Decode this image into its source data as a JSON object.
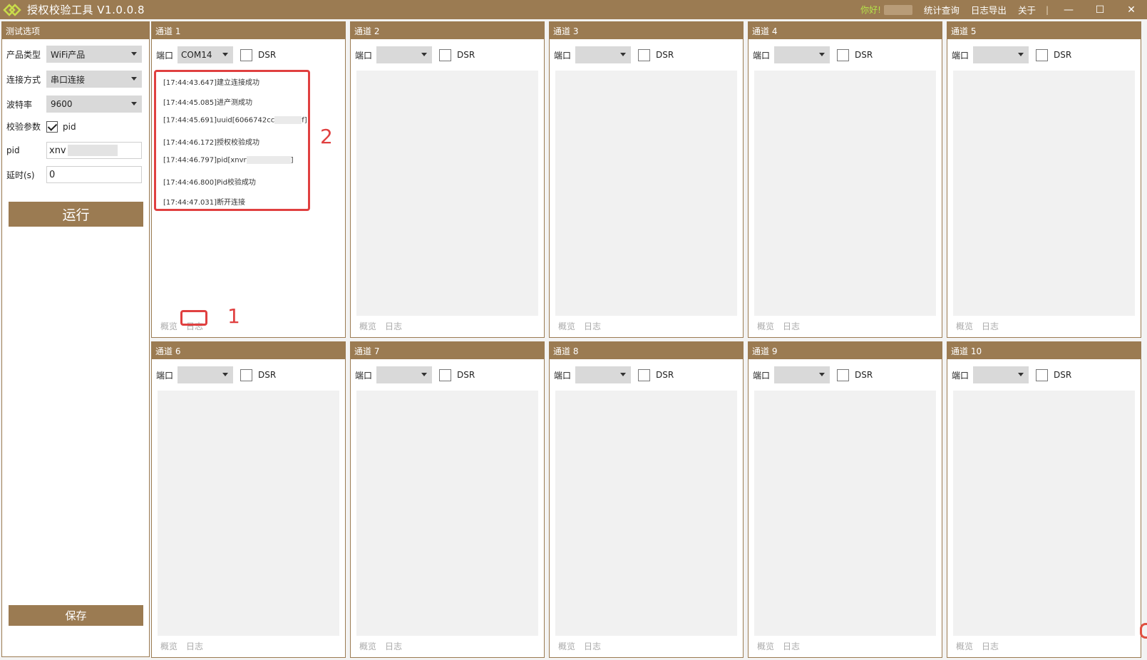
{
  "titlebar": {
    "title": "授权校验工具 V1.0.0.8",
    "greeting": "你好!",
    "menu": [
      "统计查询",
      "日志导出",
      "关于"
    ],
    "separator": "|",
    "window_buttons": {
      "minimize": "—",
      "maximize": "☐",
      "close": "✕"
    }
  },
  "left_panel": {
    "header": "测试选项",
    "product_type_label": "产品类型",
    "product_type_value": "WiFi产品",
    "connect_label": "连接方式",
    "connect_value": "串口连接",
    "baud_label": "波特率",
    "baud_value": "9600",
    "verify_label": "校验参数",
    "verify_option": "pid",
    "pid_label": "pid",
    "pid_value": "xnv",
    "delay_label": "延时(s)",
    "delay_value": "0",
    "run_label": "运行",
    "save_label": "保存"
  },
  "channel_common": {
    "port_label": "端口",
    "dsr_label": "DSR",
    "tab_overview": "概览",
    "tab_log": "日志"
  },
  "channels": [
    {
      "title": "通道 1",
      "port": "COM14"
    },
    {
      "title": "通道 2",
      "port": ""
    },
    {
      "title": "通道 3",
      "port": ""
    },
    {
      "title": "通道 4",
      "port": ""
    },
    {
      "title": "通道 5",
      "port": ""
    },
    {
      "title": "通道 6",
      "port": ""
    },
    {
      "title": "通道 7",
      "port": ""
    },
    {
      "title": "通道 8",
      "port": ""
    },
    {
      "title": "通道 9",
      "port": ""
    },
    {
      "title": "通道 10",
      "port": ""
    }
  ],
  "log_lines": [
    "[17:44:43.647]建立连接成功",
    "[17:44:45.085]进产测成功",
    "[17:44:45.691]uuid[6066742cc",
    "[17:44:46.172]授权校验成功",
    "[17:44:46.797]pid[xnvr",
    "[17:44:46.800]Pid校验成功",
    "[17:44:47.031]断开连接"
  ],
  "log_line_suffix": {
    "uuid": "f]",
    "pid": "]"
  },
  "annotations": {
    "one": "1",
    "two": "2"
  },
  "colors": {
    "brand": "#9b7b52",
    "highlight": "#e04040",
    "greeting": "#b5e34a"
  }
}
